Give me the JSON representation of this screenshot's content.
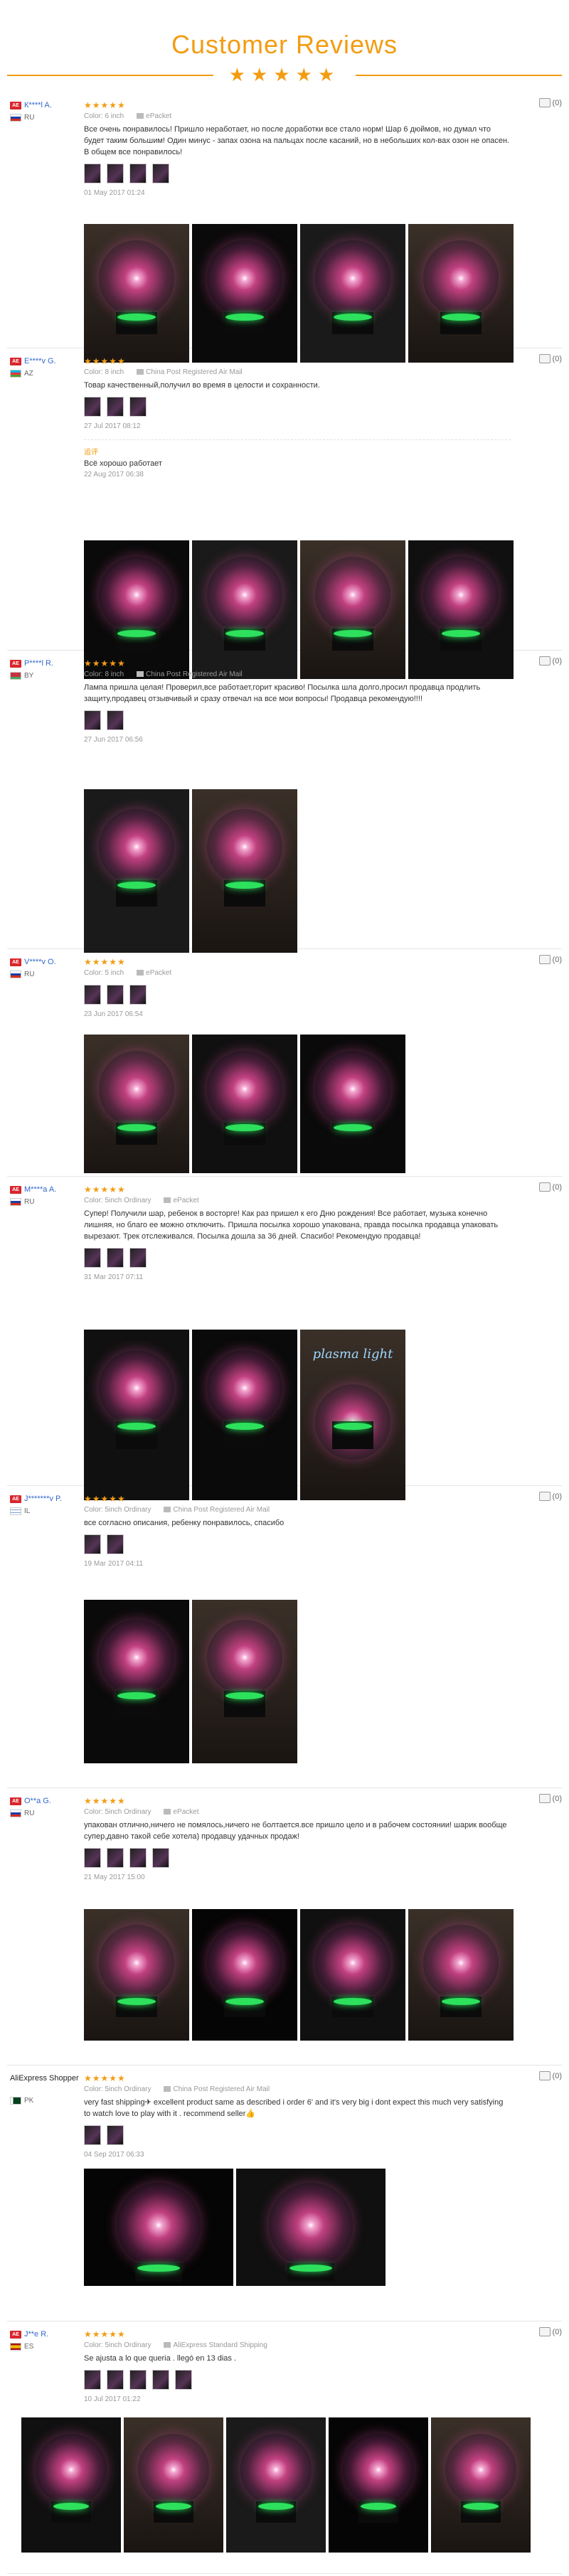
{
  "header": {
    "title": "Customer Reviews",
    "stars": "★★★★★"
  },
  "helpful_count": "(0)",
  "stars": "★★★★★",
  "reviews": [
    {
      "flag_code": "RU",
      "flag_badge": "AE",
      "name": "К****l A.",
      "country": "RU",
      "color": "Color: 6 inch",
      "shipping": "ePacket",
      "text": "Все очень понравилось! Пришло неработает, но после доработки все стало норм! Шар 6 дюймов, но думал что будет таким большим! Один минус - запах озона на пальцах после касаний, но в небольших кол-вах озон не опасен. В общем все понравилось!",
      "date": "01 May 2017 01:24",
      "thumb_count": 4,
      "photos": [
        "lamp-1",
        "lamp-2",
        "lamp-3",
        "lamp-4"
      ]
    },
    {
      "flag_code": "AZ",
      "flag_badge": "AE",
      "name": "E****v G.",
      "country": "AZ",
      "color": "Color: 8 inch",
      "shipping": "China Post Registered Air Mail",
      "text": "Товар качественный,получил во время в целости и сохранности.",
      "date": "27 Jul 2017 08:12",
      "thumb_count": 3,
      "additional_label": "追评",
      "additional_text": "Всё хорошо работает",
      "additional_date": "22 Aug 2017 06:38",
      "photos": [
        "box",
        "hand",
        "lamp",
        "lamp-dark"
      ]
    },
    {
      "flag_code": "BY",
      "flag_badge": "AE",
      "name": "P****l R.",
      "country": "BY",
      "color": "Color: 8 inch",
      "shipping": "China Post Registered Air Mail",
      "text": "Лампа пришла целая! Проверил,все работает,горит красиво! Посылка шла долго,просил продавца продлить защиту,продавец отзывчивый и сразу отвечал на все мои вопросы! Продавца рекомендую!!!!",
      "date": "27 Jun 2017 06:56",
      "thumb_count": 2,
      "photos": [
        "lamp-table",
        "lamp-glow"
      ]
    },
    {
      "flag_code": "RU",
      "flag_badge": "AE",
      "name": "V****v O.",
      "country": "RU",
      "color": "Color: 5 inch",
      "shipping": "ePacket",
      "text": "",
      "date": "23 Jun 2017 06:54",
      "thumb_count": 3,
      "photos": [
        "lamp-a",
        "lamp-b",
        "lamp-c"
      ]
    },
    {
      "flag_code": "RU",
      "flag_badge": "AE",
      "name": "M****a A.",
      "country": "RU",
      "color": "Color: 5inch Ordinary",
      "shipping": "ePacket",
      "text": "Супер! Получили шар, ребенок в восторге! Как раз пришел к его Дню рождения! Все работает, музыка конечно лишняя, но благо ее можно отключить. Пришла посылка хорошо упакована, правда посылка продавца упаковать вырезают. Трек отслеживался. Посылка дошла за 36 дней. Спасибо! Рекомендую продавца!",
      "date": "31 Mar 2017 07:11",
      "thumb_count": 3,
      "photos": [
        "lamp-x",
        "lamp-y",
        "box-plasma"
      ],
      "box_label": "plasma light"
    },
    {
      "flag_code": "IL",
      "flag_badge": "AE",
      "name": "J*******v P.",
      "country": "IL",
      "color": "Color: 5inch Ordinary",
      "shipping": "China Post Registered Air Mail",
      "text": "все согласно описания, ребенку понравилось, спасибо",
      "date": "19 Mar 2017 04:11",
      "thumb_count": 2,
      "photos": [
        "lamp-off",
        "lamp-on"
      ]
    },
    {
      "flag_code": "RU",
      "flag_badge": "AE",
      "name": "O**a G.",
      "country": "RU",
      "color": "Color: 5inch Ordinary",
      "shipping": "ePacket",
      "text": "упакован отлично,ничего не помялось,ничего не болтается.все пришло цело и в рабочем состоянии! шарик вообще супер,давно такой себе хотела) продавцу удачных продаж!",
      "date": "21 May 2017 15:00",
      "thumb_count": 4,
      "photos": [
        "p1",
        "p2",
        "p3",
        "p4"
      ]
    },
    {
      "flag_code": "PK",
      "flag_badge": "",
      "name": "AliExpress Shopper",
      "country": "PK",
      "color": "Color: 5inch Ordinary",
      "shipping": "China Post Registered Air Mail",
      "text": "very fast shipping✈ excellent product same as described i order 6' and it's very big i dont expect this much very satisfying to watch love to play with it . recommend seller👍",
      "date": "04 Sep 2017 06:33",
      "thumb_count": 2,
      "photos": [
        "desk-1",
        "desk-2"
      ]
    },
    {
      "flag_code": "ES",
      "flag_badge": "AE",
      "name": "J**e R.",
      "country": "ES",
      "color": "Color: 5inch Ordinary",
      "shipping": "AliExpress Standard Shipping",
      "text": "Se ajusta a lo que queria . llegó en 13 dias .",
      "date": "10 Jul 2017 01:22",
      "thumb_count": 5,
      "photos": [
        "box-es",
        "s2",
        "s3",
        "s4",
        "s5"
      ]
    }
  ],
  "colors": {
    "accent": "#f39c12",
    "link": "#3366cc",
    "plasma_pink": "#d44d9a",
    "plasma_green": "#2de15c"
  }
}
